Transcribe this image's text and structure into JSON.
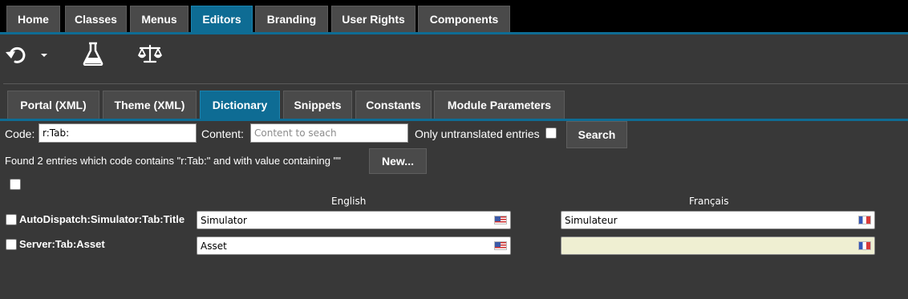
{
  "top_tabs": [
    {
      "label": "Home"
    },
    {
      "label": "Classes"
    },
    {
      "label": "Menus"
    },
    {
      "label": "Editors",
      "active": true
    },
    {
      "label": "Branding"
    },
    {
      "label": "User Rights"
    },
    {
      "label": "Components"
    }
  ],
  "toolbar": {
    "icons": [
      "undo-icon",
      "chevron-down-icon",
      "flask-icon",
      "balance-scale-icon"
    ]
  },
  "sub_tabs": [
    {
      "label": "Portal (XML)"
    },
    {
      "label": "Theme (XML)"
    },
    {
      "label": "Dictionary",
      "active": true
    },
    {
      "label": "Snippets"
    },
    {
      "label": "Constants"
    },
    {
      "label": "Module Parameters"
    }
  ],
  "filter": {
    "code_label": "Code:",
    "code_value": "r:Tab:",
    "content_label": "Content:",
    "content_placeholder": "Content to seach",
    "untranslated_label": "Only untranslated entries",
    "search_button": "Search"
  },
  "results": {
    "summary": "Found 2 entries which code contains \"r:Tab:\" and with value containing \"\"",
    "new_button": "New..."
  },
  "columns": {
    "english": "English",
    "french": "Français"
  },
  "entries": [
    {
      "key": "AutoDispatch:Simulator:Tab:Title",
      "english": "Simulator",
      "french": "Simulateur"
    },
    {
      "key": "Server:Tab:Asset",
      "english": "Asset",
      "french": ""
    }
  ],
  "colors": {
    "accent": "#0e6c94",
    "background": "#383838",
    "tab": "#4a4a4a",
    "untranslated_field": "#efefd2"
  }
}
